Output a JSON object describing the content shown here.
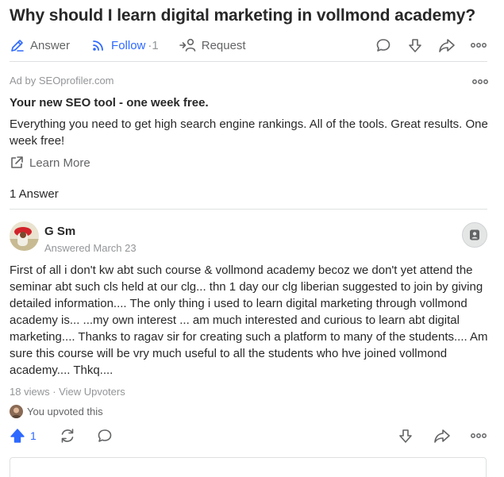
{
  "question": {
    "title": "Why should I learn digital marketing in vollmond academy?"
  },
  "actions": {
    "answer_label": "Answer",
    "follow_label": "Follow",
    "follow_separator": " · ",
    "follow_count": "1",
    "request_label": "Request"
  },
  "ad": {
    "by_label": "Ad by SEOprofiler.com",
    "title": "Your new SEO tool - one week free.",
    "body": "Everything you need to get high search engine rankings. All of the tools. Great results. One week free!",
    "learn_more": "Learn More"
  },
  "answers_count": "1 Answer",
  "answer": {
    "author": "G Sm",
    "answered_date": "Answered March 23",
    "text": "First of all i don't kw abt such course & vollmond academy becoz we don't yet attend the seminar abt such cls held at our clg... thn 1 day our clg liberian suggested to join by giving detailed information.... The only thing i used to learn digital marketing through vollmond academy is... ...my own interest ... am much interested and curious to learn abt digital marketing.... Thanks to ragav sir for creating such a platform to many of the students.... Am sure this course will be vry much useful to all the students who hve joined vollmond academy.... Thkq....",
    "views": "18 views",
    "stats_separator": " · ",
    "view_upvoters": "View Upvoters",
    "you_upvoted": "You upvoted this",
    "upvote_count": "1"
  },
  "colors": {
    "accent_blue": "#2e69ff",
    "text_primary": "#282829",
    "text_secondary": "#636466",
    "text_muted": "#939598",
    "divider": "#dee0e1"
  },
  "icons": [
    "edit-icon",
    "follow-signal-icon",
    "request-person-icon",
    "comment-icon",
    "downvote-icon",
    "share-icon",
    "more-icon",
    "external-link-icon",
    "notify-bell-icon",
    "upvote-icon",
    "reshare-icon"
  ]
}
